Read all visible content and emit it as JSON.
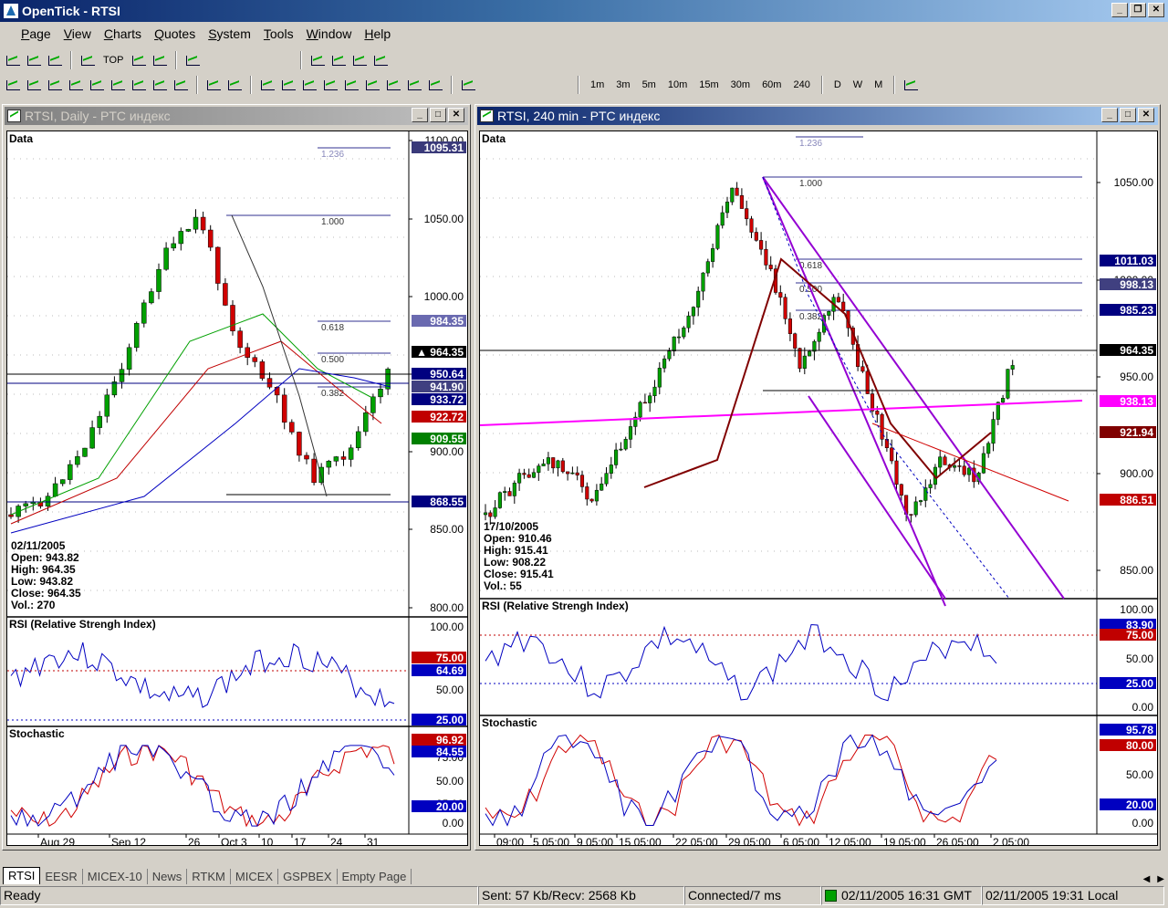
{
  "window": {
    "title": "OpenTick - RTSI"
  },
  "menu": [
    "Page",
    "View",
    "Charts",
    "Quotes",
    "System",
    "Tools",
    "Window",
    "Help"
  ],
  "toolbar1": {
    "top_label": "TOP"
  },
  "toolbar2": {
    "timeframes": [
      "1m",
      "3m",
      "5m",
      "10m",
      "15m",
      "30m",
      "60m",
      "240",
      "D",
      "W",
      "M"
    ]
  },
  "left_chart": {
    "title": "RTSI, Daily - PTC индекс",
    "data_label": "Data",
    "price_axis": [
      "1100.00",
      "1050.00",
      "1000.00",
      "950.00",
      "900.00",
      "850.00",
      "800.00"
    ],
    "price_tags": [
      {
        "text": "1095.31",
        "color": "#ffffff",
        "bg": "#3a3a7a"
      },
      {
        "text": "984.35",
        "color": "#ffffff",
        "bg": "#6a6ab0"
      },
      {
        "text": "▲ 964.35",
        "color": "#ffffff",
        "bg": "#000000"
      },
      {
        "text": "950.64",
        "color": "#ffffff",
        "bg": "#000080"
      },
      {
        "text": "941.90",
        "color": "#ffffff",
        "bg": "#404080"
      },
      {
        "text": "933.72",
        "color": "#ffffff",
        "bg": "#000080"
      },
      {
        "text": "922.72",
        "color": "#ffffff",
        "bg": "#c00000"
      },
      {
        "text": "909.55",
        "color": "#ffffff",
        "bg": "#008000"
      },
      {
        "text": "868.55",
        "color": "#ffffff",
        "bg": "#000080"
      }
    ],
    "fib_labels": [
      "1.236",
      "1.000",
      "0.618",
      "0.500",
      "0.382"
    ],
    "info": {
      "date": "02/11/2005",
      "open": "Open: 943.82",
      "high": "High: 964.35",
      "low": "Low: 943.82",
      "close": "Close: 964.35",
      "vol": "Vol.: 270"
    },
    "rsi": {
      "label": "RSI (Relative Strengh Index)",
      "axis": [
        "100.00",
        "50.00"
      ],
      "tags": [
        {
          "text": "75.00",
          "color": "#ffffff",
          "bg": "#c00000"
        },
        {
          "text": "64.69",
          "color": "#ffffff",
          "bg": "#0000c0"
        },
        {
          "text": "25.00",
          "color": "#ffffff",
          "bg": "#0000c0"
        }
      ]
    },
    "stoch": {
      "label": "Stochastic",
      "axis": [
        "75.00",
        "50.00",
        "25.00",
        "0.00"
      ],
      "tags": [
        {
          "text": "96.92",
          "color": "#ffffff",
          "bg": "#c00000"
        },
        {
          "text": "84.55",
          "color": "#ffffff",
          "bg": "#0000c0"
        },
        {
          "text": "20.00",
          "color": "#ffffff",
          "bg": "#0000c0"
        }
      ]
    },
    "date_axis": [
      "Aug 29",
      "Sep 12",
      "26",
      "Oct 3",
      "10",
      "17",
      "24",
      "31"
    ]
  },
  "right_chart": {
    "title": "RTSI, 240 min - PTC индекс",
    "data_label": "Data",
    "price_axis": [
      "1050.00",
      "1000.00",
      "950.00",
      "900.00",
      "850.00"
    ],
    "price_tags": [
      {
        "text": "1011.03",
        "color": "#ffffff",
        "bg": "#000080"
      },
      {
        "text": "998.13",
        "color": "#ffffff",
        "bg": "#404080"
      },
      {
        "text": "985.23",
        "color": "#ffffff",
        "bg": "#000080"
      },
      {
        "text": "964.35",
        "color": "#ffffff",
        "bg": "#000000"
      },
      {
        "text": "938.13",
        "color": "#ffffff",
        "bg": "#ff00ff"
      },
      {
        "text": "921.94",
        "color": "#ffffff",
        "bg": "#800000"
      },
      {
        "text": "886.51",
        "color": "#ffffff",
        "bg": "#c00000"
      }
    ],
    "fib_labels": [
      "1.236",
      "1.000",
      "0.618",
      "0.500",
      "0.382"
    ],
    "info": {
      "date": "17/10/2005",
      "open": "Open: 910.46",
      "high": "High: 915.41",
      "low": "Low: 908.22",
      "close": "Close: 915.41",
      "vol": "Vol.: 55"
    },
    "rsi": {
      "label": "RSI (Relative Strengh Index)",
      "axis": [
        "100.00",
        "50.00",
        "0.00"
      ],
      "tags": [
        {
          "text": "83.90",
          "color": "#ffffff",
          "bg": "#0000c0"
        },
        {
          "text": "75.00",
          "color": "#ffffff",
          "bg": "#c00000"
        },
        {
          "text": "25.00",
          "color": "#ffffff",
          "bg": "#0000c0"
        }
      ]
    },
    "stoch": {
      "label": "Stochastic",
      "axis": [
        "50.00",
        "0.00"
      ],
      "tags": [
        {
          "text": "95.78",
          "color": "#ffffff",
          "bg": "#0000c0"
        },
        {
          "text": "80.00",
          "color": "#ffffff",
          "bg": "#c00000"
        },
        {
          "text": "20.00",
          "color": "#ffffff",
          "bg": "#0000c0"
        }
      ]
    },
    "date_axis": [
      "09:00",
      "5 05:00",
      "9 05:00",
      "15 05:00",
      "22 05:00",
      "29 05:00",
      "6 05:00",
      "12 05:00",
      "19 05:00",
      "26 05:00",
      "2 05:00"
    ]
  },
  "tabs": [
    "RTSI",
    "EESR",
    "MICEX-10",
    "News",
    "RTKM",
    "MICEX",
    "GSPBEX",
    "Empty Page"
  ],
  "status": {
    "ready": "Ready",
    "traffic": "Sent: 57 Kb/Recv: 2568 Kb",
    "connection": "Connected/7 ms",
    "gmt": "02/11/2005 16:31 GMT",
    "local": "02/11/2005 19:31 Local"
  }
}
